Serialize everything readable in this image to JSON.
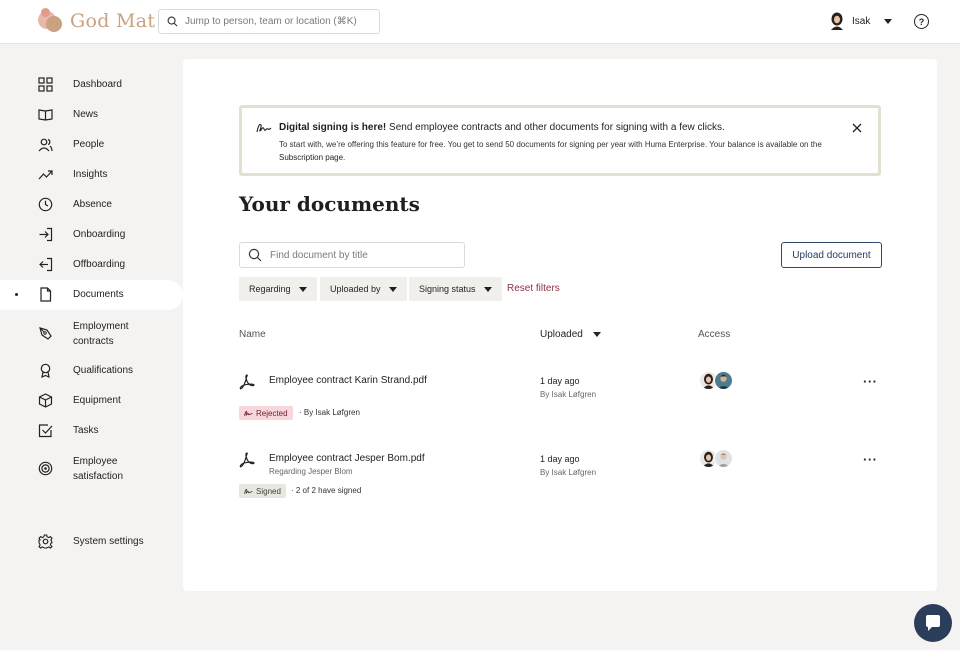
{
  "brand": {
    "name": "God Mat"
  },
  "search": {
    "placeholder": "Jump to person, team or location (⌘K)"
  },
  "user": {
    "name": "Isak"
  },
  "sidebar": {
    "items": [
      {
        "label": "Dashboard",
        "icon": "grid-icon"
      },
      {
        "label": "News",
        "icon": "book-icon"
      },
      {
        "label": "People",
        "icon": "people-icon"
      },
      {
        "label": "Insights",
        "icon": "trend-icon"
      },
      {
        "label": "Absence",
        "icon": "clock-icon"
      },
      {
        "label": "Onboarding",
        "icon": "login-icon"
      },
      {
        "label": "Offboarding",
        "icon": "logout-icon"
      },
      {
        "label": "Documents",
        "icon": "document-icon",
        "active": true
      },
      {
        "label": "Employment contracts",
        "icon": "pen-icon"
      },
      {
        "label": "Qualifications",
        "icon": "award-icon"
      },
      {
        "label": "Equipment",
        "icon": "box-icon"
      },
      {
        "label": "Tasks",
        "icon": "checkbox-icon"
      },
      {
        "label": "Employee satisfaction",
        "icon": "target-icon"
      }
    ],
    "settings_label": "System settings"
  },
  "banner": {
    "title_bold": "Digital signing is here!",
    "title_rest": " Send employee contracts and other documents for signing with a few clicks.",
    "desc": "To start with, we’re offering this feature for free. You get to send 50 documents for signing per year with Huma Enterprise. Your balance is available on the ",
    "desc_link": "Subscription page",
    "desc_end": "."
  },
  "page": {
    "title": "Your documents",
    "search_placeholder": "Find document by title",
    "upload_label": "Upload document"
  },
  "filters": {
    "regarding": "Regarding",
    "uploaded_by": "Uploaded by",
    "signing_status": "Signing status",
    "reset": "Reset filters"
  },
  "table": {
    "headers": {
      "name": "Name",
      "uploaded": "Uploaded",
      "access": "Access"
    },
    "rows": [
      {
        "name": "Employee contract Karin Strand.pdf",
        "regarding": "",
        "date": "1 day ago",
        "by": "By Isak Løfgren",
        "status": "Rejected",
        "status_note": "· By Isak Løfgren"
      },
      {
        "name": "Employee contract Jesper Bom.pdf",
        "regarding": "Regarding Jesper Blom",
        "date": "1 day ago",
        "by": "By Isak Løfgren",
        "status": "Signed",
        "status_note": "· 2 of 2 have signed"
      }
    ]
  },
  "colors": {
    "accent": "#1d3b5e",
    "reset": "#8a3344",
    "rejected_bg": "#f7d7dc",
    "signed_bg": "#e6e8df"
  }
}
